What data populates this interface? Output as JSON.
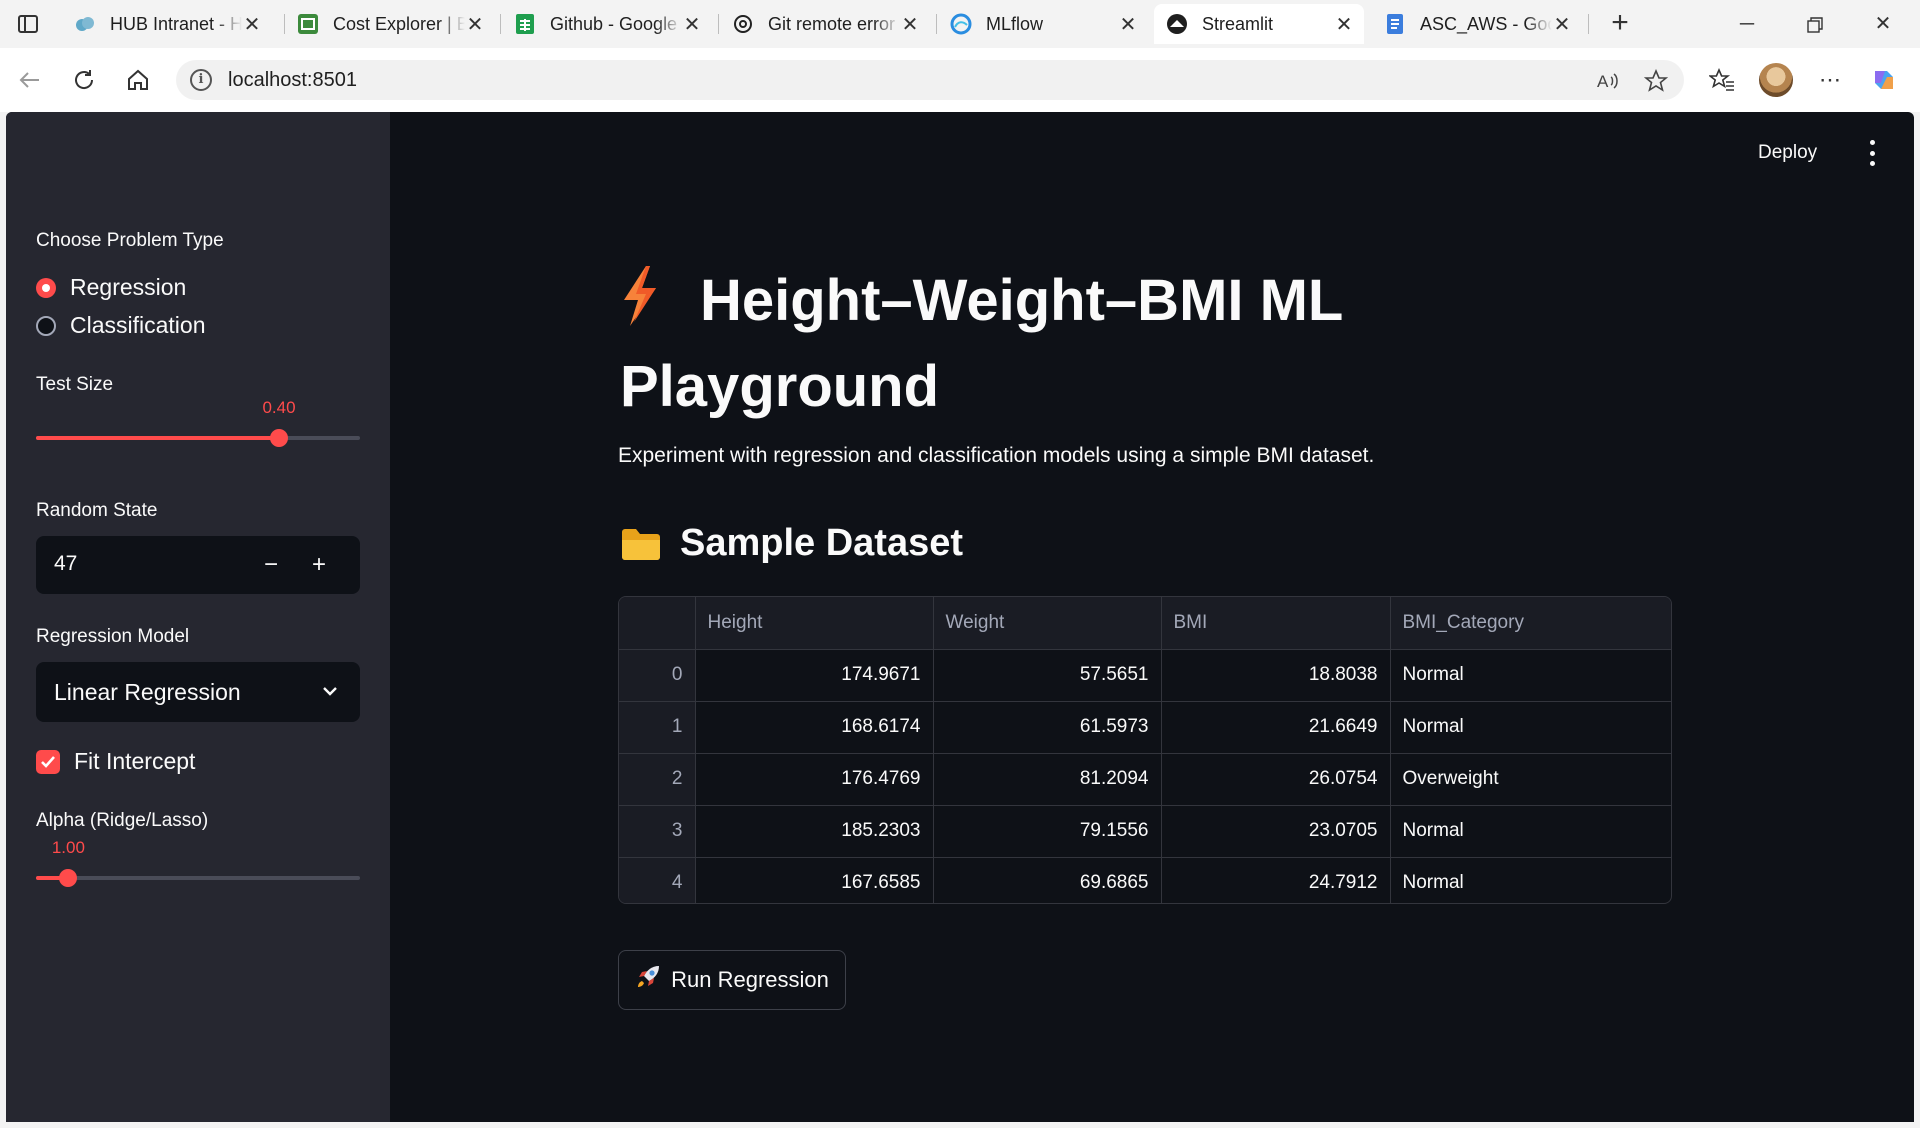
{
  "browser": {
    "tabs": [
      {
        "title": "HUB Intranet - Home",
        "icon": "hub-cloud-icon",
        "active": false
      },
      {
        "title": "Cost Explorer | Billing",
        "icon": "cost-explorer-icon",
        "active": false
      },
      {
        "title": "Github - Google Sheets",
        "icon": "sheets-icon",
        "active": false
      },
      {
        "title": "Git remote error",
        "icon": "openai-icon",
        "active": false
      },
      {
        "title": "MLflow",
        "icon": "mlflow-icon",
        "active": false
      },
      {
        "title": "Streamlit",
        "icon": "streamlit-icon",
        "active": true
      },
      {
        "title": "ASC_AWS - Google Docs",
        "icon": "docs-icon",
        "active": false
      }
    ],
    "url": "localhost:8501",
    "colors": {
      "tab_strip": "#f3f3f3",
      "accent": "#ff4b4b"
    }
  },
  "header": {
    "deploy_label": "Deploy"
  },
  "sidebar": {
    "problem_type": {
      "label": "Choose Problem Type",
      "options": [
        "Regression",
        "Classification"
      ],
      "selected": "Regression"
    },
    "test_size": {
      "label": "Test Size",
      "value": "0.40",
      "fraction": 0.75
    },
    "random_state": {
      "label": "Random State",
      "value": "47",
      "minus": "−",
      "plus": "+"
    },
    "model": {
      "label": "Regression Model",
      "selected": "Linear Regression"
    },
    "fit_intercept": {
      "label": "Fit Intercept",
      "checked": true
    },
    "alpha": {
      "label": "Alpha (Ridge/Lasso)",
      "value": "1.00",
      "fraction": 0.1
    }
  },
  "main": {
    "title": "Height–Weight–BMI ML Playground",
    "title_icon": "lightning-icon",
    "description": "Experiment with regression and classification models using a simple BMI dataset.",
    "dataset_heading": "Sample Dataset",
    "dataset_icon": "folder-icon",
    "table": {
      "columns": [
        "",
        "Height",
        "Weight",
        "BMI",
        "BMI_Category"
      ],
      "rows": [
        [
          "0",
          "174.9671",
          "57.5651",
          "18.8038",
          "Normal"
        ],
        [
          "1",
          "168.6174",
          "61.5973",
          "21.6649",
          "Normal"
        ],
        [
          "2",
          "176.4769",
          "81.2094",
          "26.0754",
          "Overweight"
        ],
        [
          "3",
          "185.2303",
          "79.1556",
          "23.0705",
          "Normal"
        ],
        [
          "4",
          "167.6585",
          "69.6865",
          "24.7912",
          "Normal"
        ]
      ]
    },
    "run_button": {
      "label": "Run Regression",
      "icon": "rocket-icon"
    }
  }
}
